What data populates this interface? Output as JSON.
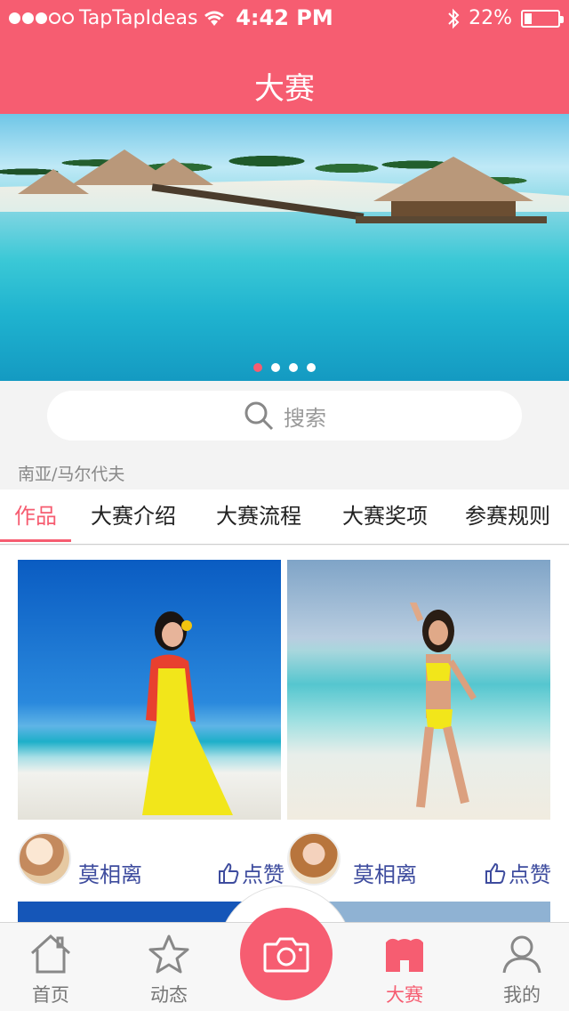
{
  "status_bar": {
    "carrier": "TapTapIdeas",
    "time": "4:42 PM",
    "battery": "22%",
    "battery_level": 0.22,
    "signal_bars": 3
  },
  "header": {
    "title": "大赛"
  },
  "banner": {
    "page_count": 4,
    "active_page": 0
  },
  "search": {
    "placeholder": "搜索"
  },
  "location": "南亚/马尔代夫",
  "tabs": [
    {
      "label": "作品",
      "active": true
    },
    {
      "label": "大赛介绍"
    },
    {
      "label": "大赛流程"
    },
    {
      "label": "大赛奖项"
    },
    {
      "label": "参赛规则"
    }
  ],
  "posts": [
    {
      "author": "莫相离",
      "like_label": "点赞"
    },
    {
      "author": "莫相离",
      "like_label": "点赞"
    }
  ],
  "nav": {
    "items": [
      {
        "label": "首页",
        "icon": "home-icon"
      },
      {
        "label": "动态",
        "icon": "star-icon"
      },
      {
        "label": "大赛",
        "icon": "contest-icon",
        "active": true
      },
      {
        "label": "我的",
        "icon": "user-icon"
      }
    ],
    "camera_icon": "camera-icon"
  },
  "colors": {
    "accent": "#f65d71",
    "link": "#3e4c9e"
  }
}
